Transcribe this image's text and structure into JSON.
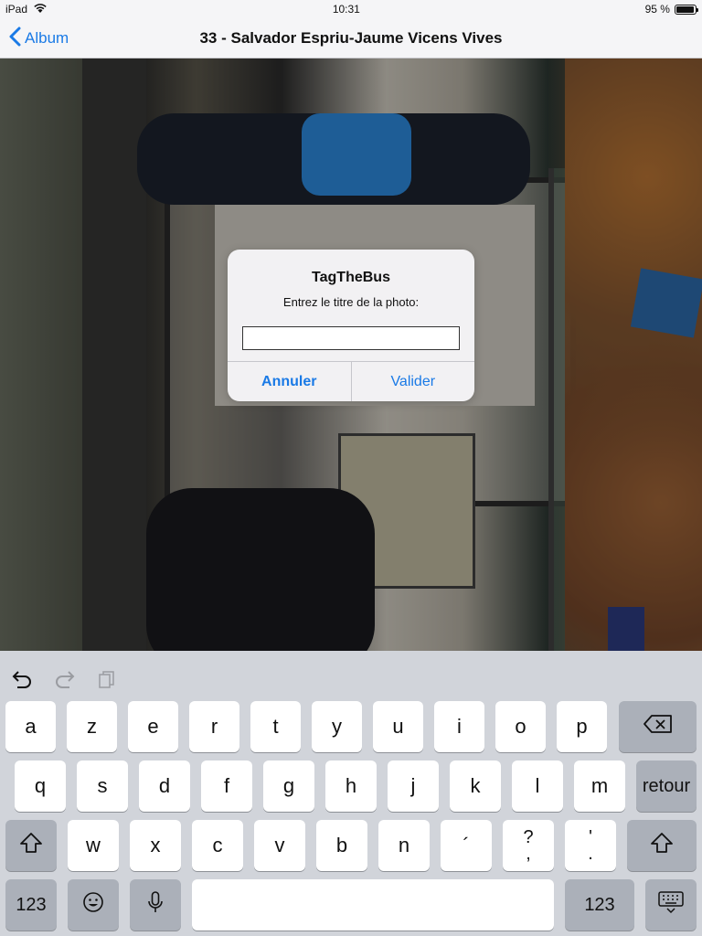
{
  "statusbar": {
    "device": "iPad",
    "time": "10:31",
    "battery": "95 %",
    "battery_level": 0.95
  },
  "navbar": {
    "back_label": "Album",
    "title": "33 - Salvador Espriu-Jaume Vicens Vives"
  },
  "alert": {
    "title": "TagTheBus",
    "message": "Entrez le titre de la photo:",
    "input_value": "",
    "cancel_label": "Annuler",
    "confirm_label": "Valider"
  },
  "keyboard": {
    "row1": [
      "a",
      "z",
      "e",
      "r",
      "t",
      "y",
      "u",
      "i",
      "o",
      "p"
    ],
    "row2": [
      "q",
      "s",
      "d",
      "f",
      "g",
      "h",
      "j",
      "k",
      "l",
      "m"
    ],
    "row3": [
      "w",
      "x",
      "c",
      "v",
      "b",
      "n",
      "´"
    ],
    "return_label": "retour",
    "numbers_label": "123",
    "punct1": {
      "top": "?",
      "bottom": ","
    },
    "punct2": {
      "top": "'",
      "bottom": "."
    }
  },
  "colors": {
    "accent": "#1a7ae6",
    "keyboard_bg": "#d1d4da"
  }
}
